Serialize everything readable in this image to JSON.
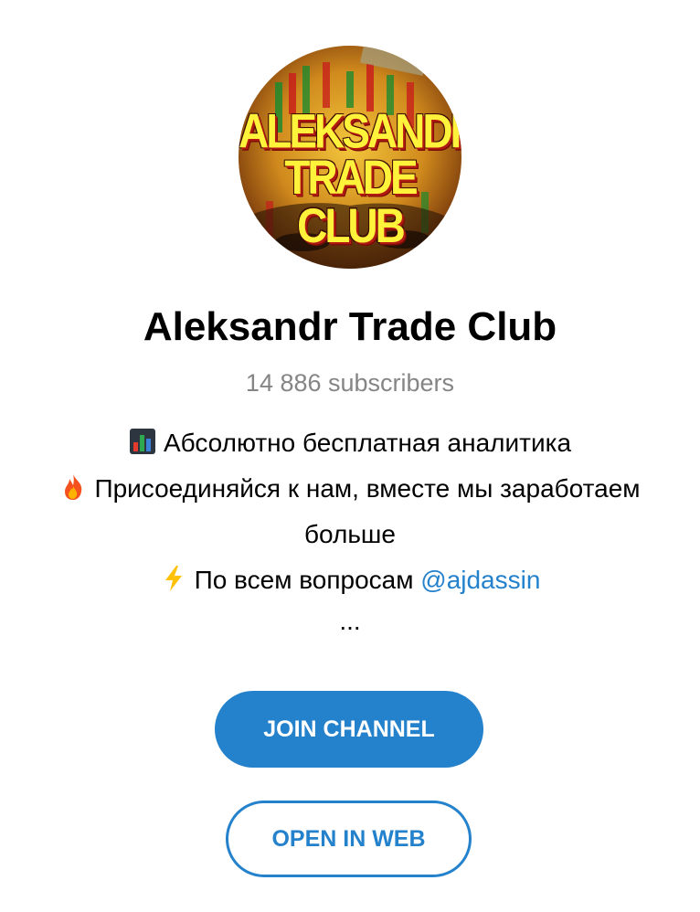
{
  "channel": {
    "avatar_text_line1": "ALEKSANDR",
    "avatar_text_line2": "TRADE CLUB",
    "title": "Aleksandr Trade Club",
    "subscribers": "14 886 subscribers"
  },
  "description": {
    "line1_icon": "bar-chart-emoji-icon",
    "line1_text": "Абсолютно бесплатная аналитика",
    "line2_icon": "fire-emoji-icon",
    "line2_text": "Присоединяйся к нам, вместе мы заработаем",
    "line3_text": "больше",
    "line4_icon": "lightning-emoji-icon",
    "line4_text": "По всем вопросам ",
    "line4_mention": "@ajdassin",
    "ellipsis": "..."
  },
  "buttons": {
    "join_label": "JOIN CHANNEL",
    "web_label": "OPEN IN WEB"
  },
  "colors": {
    "accent": "#2481cc",
    "subtitle": "#858585",
    "text": "#000000",
    "background": "#ffffff"
  }
}
